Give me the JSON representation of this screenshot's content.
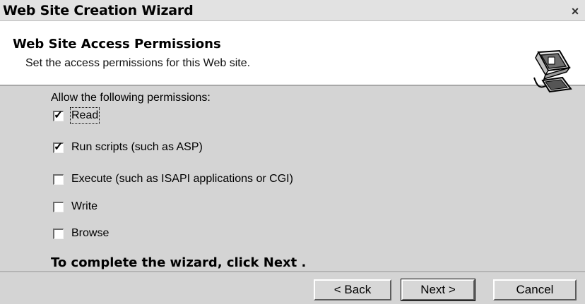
{
  "window": {
    "title": "Web Site Creation Wizard",
    "close_glyph": "×"
  },
  "header": {
    "title": "Web Site Access Permissions",
    "subtitle": "Set the access permissions for this Web site.",
    "icon": "wizard-book-icon"
  },
  "content": {
    "prompt": "Allow the following permissions:",
    "permissions": [
      {
        "label": "Read",
        "checked": true
      },
      {
        "label": "Run scripts (such as ASP)",
        "checked": true
      },
      {
        "label": "Execute (such as ISAPI applications or CGI)",
        "checked": false
      },
      {
        "label": "Write",
        "checked": false
      },
      {
        "label": "Browse",
        "checked": false
      }
    ],
    "complete_text": "To complete the wizard, click Next ."
  },
  "footer": {
    "back_label": "< Back",
    "next_label": "Next >",
    "cancel_label": "Cancel"
  }
}
